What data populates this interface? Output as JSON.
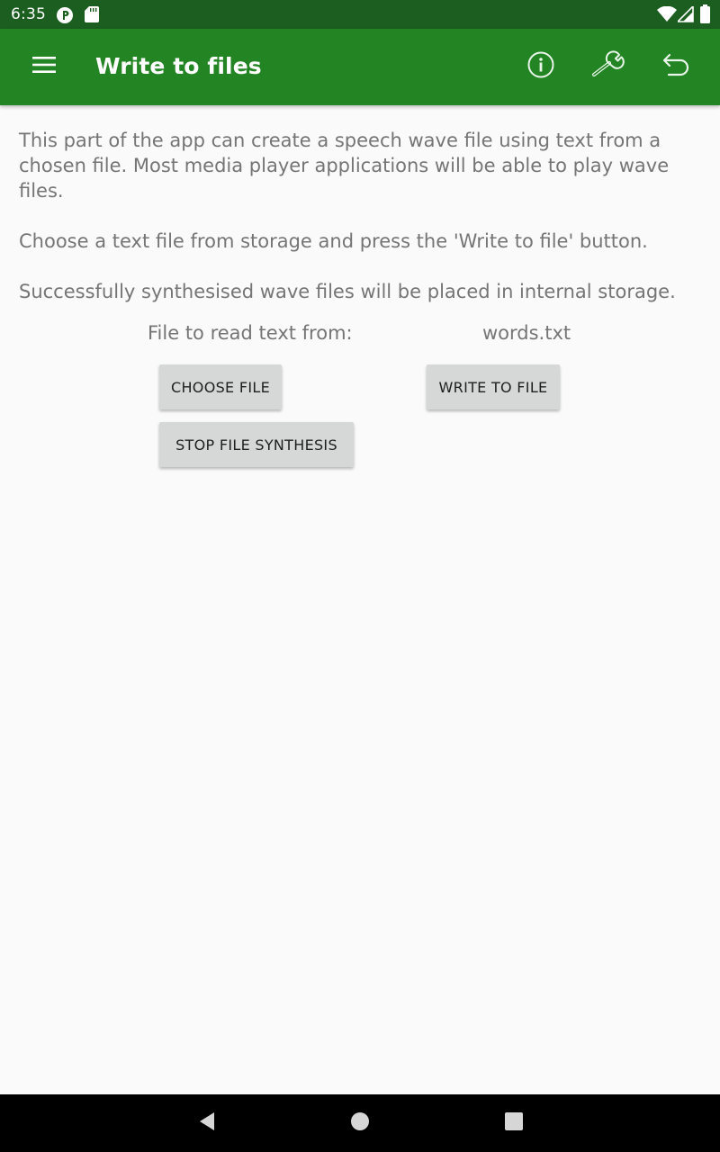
{
  "status_bar": {
    "time": "6:35",
    "icons": [
      "play-protect-icon",
      "sd-card-icon",
      "wifi-icon",
      "signal-icon",
      "battery-icon"
    ]
  },
  "app_bar": {
    "title": "Write to files",
    "icons": [
      "menu-icon",
      "info-icon",
      "wrench-icon",
      "undo-icon"
    ],
    "background_color": "#238423"
  },
  "content": {
    "paragraphs": [
      "This part of the app can create a speech wave file using text from a chosen file. Most media player applications will be able to play wave files.",
      "Choose a text file from storage and press the 'Write to file' button.",
      "Successfully synthesised wave files will be placed in internal storage."
    ],
    "file_label": "File to read text from:",
    "file_value": "words.txt",
    "buttons": {
      "choose_file": "CHOOSE FILE",
      "write_to_file": "WRITE TO FILE",
      "stop_synthesis": "STOP FILE SYNTHESIS"
    }
  },
  "nav_bar": {
    "icons": [
      "back-icon",
      "home-icon",
      "recents-icon"
    ]
  }
}
